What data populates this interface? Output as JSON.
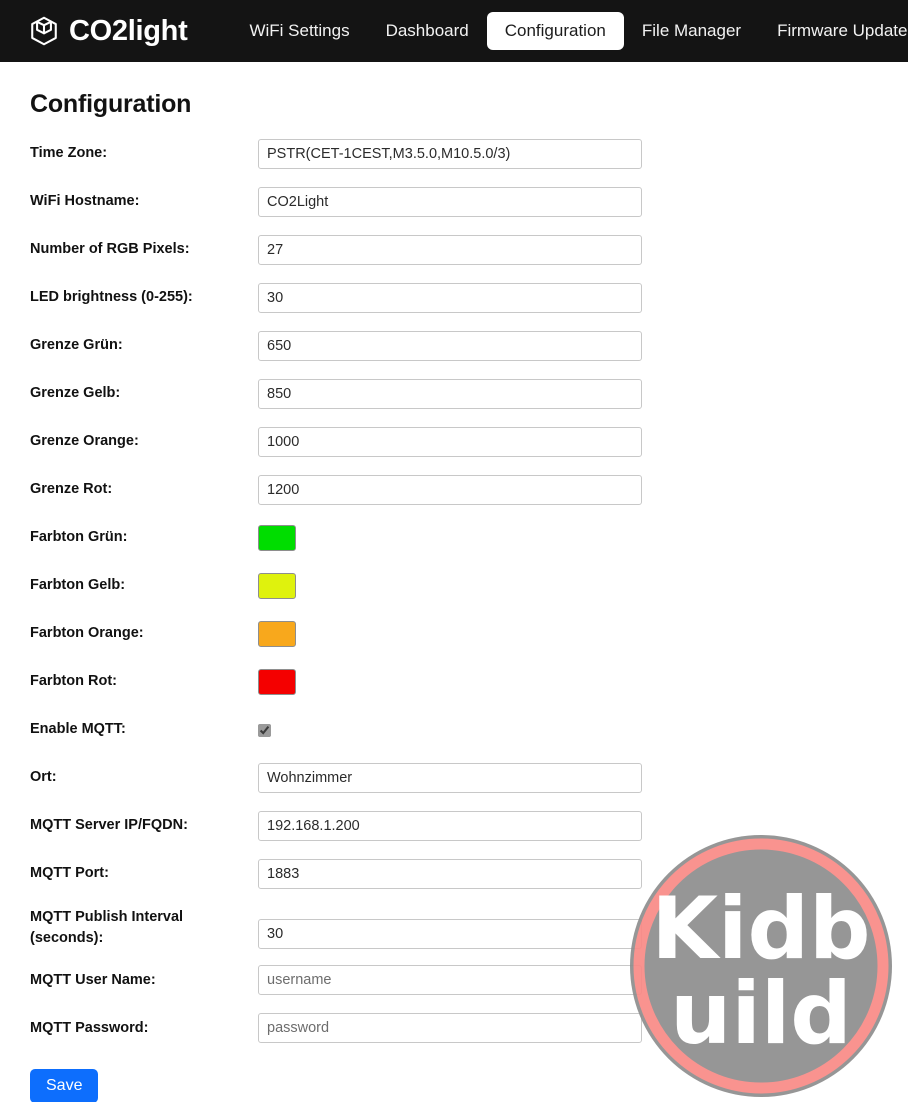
{
  "navbar": {
    "brand": "CO2light",
    "brand_icon": "cube-icon",
    "items": [
      {
        "label": "WiFi Settings",
        "active": false
      },
      {
        "label": "Dashboard",
        "active": false
      },
      {
        "label": "Configuration",
        "active": true
      },
      {
        "label": "File Manager",
        "active": false
      },
      {
        "label": "Firmware Update",
        "active": false
      }
    ]
  },
  "page": {
    "title": "Configuration"
  },
  "form": {
    "time_zone": {
      "label": "Time Zone:",
      "value": "PSTR(CET-1CEST,M3.5.0,M10.5.0/3)"
    },
    "wifi_hostname": {
      "label": "WiFi Hostname:",
      "value": "CO2Light"
    },
    "rgb_pixels": {
      "label": "Number of RGB Pixels:",
      "value": "27"
    },
    "led_brightness": {
      "label": "LED brightness (0-255):",
      "value": "30"
    },
    "grenze_gruen": {
      "label": "Grenze Grün:",
      "value": "650"
    },
    "grenze_gelb": {
      "label": "Grenze Gelb:",
      "value": "850"
    },
    "grenze_orange": {
      "label": "Grenze Orange:",
      "value": "1000"
    },
    "grenze_rot": {
      "label": "Grenze Rot:",
      "value": "1200"
    },
    "farbton_gruen": {
      "label": "Farbton Grün:",
      "color": "#00dd00"
    },
    "farbton_gelb": {
      "label": "Farbton Gelb:",
      "color": "#dff20d"
    },
    "farbton_orange": {
      "label": "Farbton Orange:",
      "color": "#f8a81c"
    },
    "farbton_rot": {
      "label": "Farbton Rot:",
      "color": "#f40000"
    },
    "enable_mqtt": {
      "label": "Enable MQTT:",
      "checked": true
    },
    "ort": {
      "label": "Ort:",
      "value": "Wohnzimmer"
    },
    "mqtt_server": {
      "label": "MQTT Server IP/FQDN:",
      "value": "192.168.1.200"
    },
    "mqtt_port": {
      "label": "MQTT Port:",
      "value": "1883"
    },
    "mqtt_interval": {
      "label": "MQTT Publish Interval (seconds):",
      "value": "30"
    },
    "mqtt_user": {
      "label": "MQTT User Name:",
      "placeholder": "username",
      "value": ""
    },
    "mqtt_password": {
      "label": "MQTT Password:",
      "placeholder": "password",
      "value": ""
    },
    "save_label": "Save"
  },
  "watermark": {
    "text_top": "Kid",
    "text_bottom": "uild",
    "ring_color": "#f98a86",
    "fill_color": "#8e8e8e",
    "text_color": "#ffffff"
  },
  "theme": {
    "navbar_bg": "#141414",
    "accent": "#0d6efd",
    "page_bg": "#ffffff"
  }
}
